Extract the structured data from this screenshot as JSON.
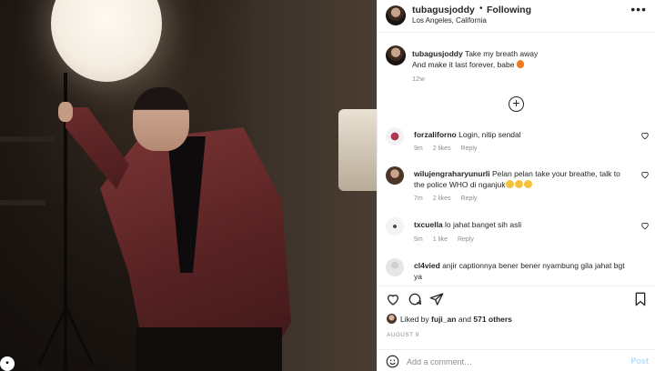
{
  "header": {
    "username": "tubagusjoddy",
    "separator": "•",
    "follow_status": "Following",
    "location": "Los Angeles, California",
    "more_icon": "more-horizontal-icon"
  },
  "caption": {
    "username": "tubagusjoddy",
    "text_line1": "Take my breath away",
    "text_line2": "And make it last forever, babe",
    "emoji": "fire",
    "time": "12w"
  },
  "comments": [
    {
      "username": "forzaliforno",
      "text": "Login, nitip sendal",
      "time": "9m",
      "likes": "2 likes",
      "reply": "Reply"
    },
    {
      "username": "wilujengraharyunurli",
      "text": "Pelan pelan take your breathe, talk to the police WHO di nganjuk",
      "emoji_count": 3,
      "time": "7m",
      "likes": "2 likes",
      "reply": "Reply"
    },
    {
      "username": "txcuella",
      "text": "lo jahat banget sih asli",
      "time": "5m",
      "likes": "1 like",
      "reply": "Reply"
    },
    {
      "username": "cl4vied",
      "text": "anjir captionnya bener bener nyambung gila jahat bgt ya"
    }
  ],
  "actions": {
    "like_icon": "heart-icon",
    "comment_icon": "comment-icon",
    "share_icon": "share-icon",
    "save_icon": "bookmark-icon"
  },
  "likes": {
    "prefix": "Liked by",
    "user": "fuji_an",
    "and": "and",
    "others": "571 others"
  },
  "date": "AUGUST 9",
  "add_comment": {
    "placeholder": "Add a comment…",
    "post_label": "Post"
  },
  "colors": {
    "text": "#262626",
    "muted": "#8e8e8e",
    "post_disabled": "#b2dffc",
    "border": "#efefef"
  }
}
